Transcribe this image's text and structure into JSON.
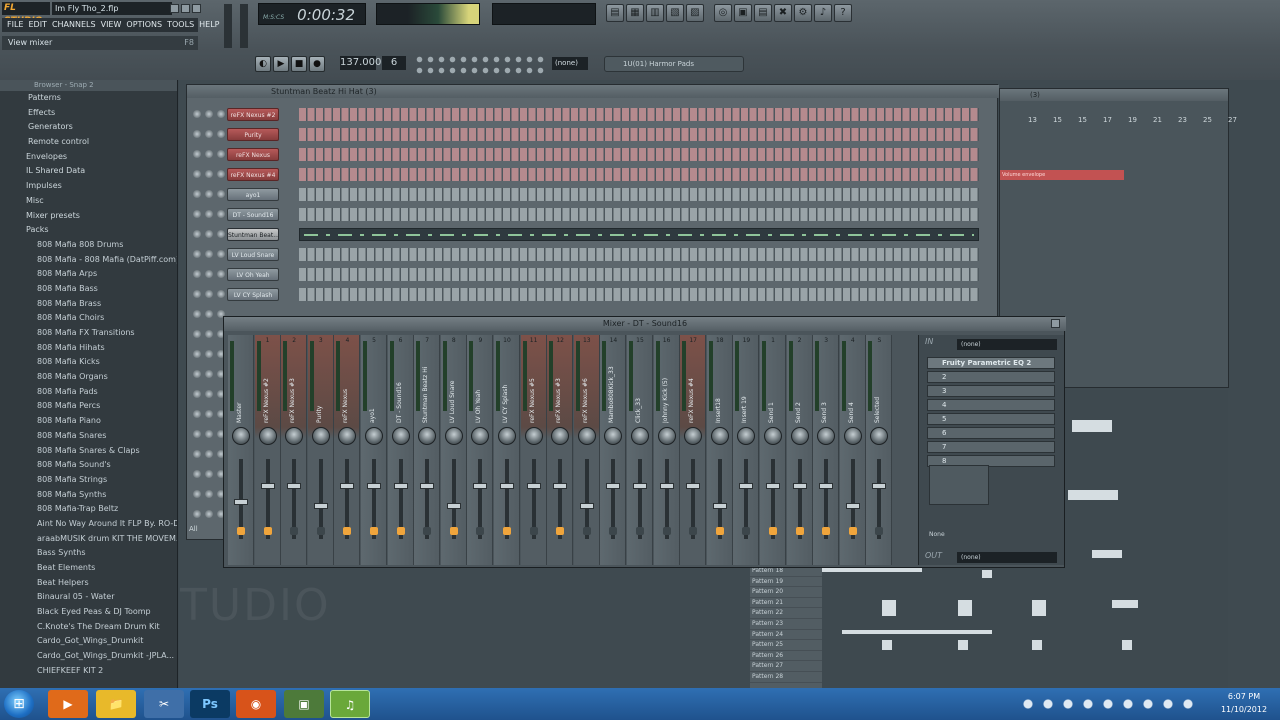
{
  "app": {
    "logo": "FL STUDIO",
    "song_title": "Im Fly Tho_2.flp",
    "hint": "View mixer",
    "hint_key": "F8"
  },
  "menu": [
    "FILE",
    "EDIT",
    "CHANNELS",
    "VIEW",
    "OPTIONS",
    "TOOLS",
    "HELP"
  ],
  "transport": {
    "time": "0:00:32",
    "tempo": "137.000",
    "pattern": "6",
    "snap": "(none)",
    "hint_panel": "1U(01) Harmor Pads"
  },
  "browser": {
    "title": "Browser - Snap 2",
    "folders": [
      "Patterns",
      "Effects",
      "Generators",
      "Remote control"
    ],
    "roots": [
      "Envelopes",
      "IL Shared Data",
      "Impulses",
      "Misc",
      "Mixer presets",
      "Packs"
    ],
    "packs": [
      "808 Mafia 808 Drums",
      "808 Mafia - 808 Mafia (DatPiff.com)",
      "808 Mafia Arps",
      "808 Mafia Bass",
      "808 Mafia Brass",
      "808 Mafia Choirs",
      "808 Mafia FX Transitions",
      "808 Mafia Hihats",
      "808 Mafia Kicks",
      "808 Mafia Organs",
      "808 Mafia Pads",
      "808 Mafia Percs",
      "808 Mafia Piano",
      "808 Mafia Snares",
      "808 Mafia Snares & Claps",
      "808 Mafia Sound's",
      "808 Mafia Strings",
      "808 Mafia Synths",
      "808 Mafia-Trap Beltz",
      "Aint No Way Around It FLP By. RO-D",
      "araabMUSIK drum KIT THE MOVEM...",
      "Bass Synths",
      "Beat Elements",
      "Beat Helpers",
      "Binaural 05 - Water",
      "Black Eyed Peas & DJ Toomp",
      "C.Knote's The Dream Drum Kit",
      "Cardo_Got_Wings_Drumkit",
      "Cardo_Got_Wings_Drumkit -JPLA...",
      "CHIEFKEEF KIT 2"
    ]
  },
  "step_sequencer": {
    "title": "Stuntman Beatz Hi Hat (3)",
    "filter": "All",
    "channels": [
      {
        "label": "reFX Nexus #2",
        "style": "red"
      },
      {
        "label": "Purity",
        "style": "red"
      },
      {
        "label": "reFX Nexus",
        "style": "red"
      },
      {
        "label": "reFX Nexus #4",
        "style": "red"
      },
      {
        "label": "ayo1",
        "style": "grey"
      },
      {
        "label": "DT - Sound16",
        "style": "grey"
      },
      {
        "label": "Stuntman Beat...",
        "style": "sel"
      },
      {
        "label": "LV Loud Snare",
        "style": "grey"
      },
      {
        "label": "LV Oh Yeah",
        "style": "grey"
      },
      {
        "label": "LV CY Splash",
        "style": "grey"
      }
    ]
  },
  "playlist": {
    "title": "(3)",
    "ruler": [
      "13",
      "15",
      "15",
      "17",
      "19",
      "21",
      "23",
      "25",
      "27"
    ],
    "envelope": "Volume envelope",
    "patterns": [
      "Pattern 18",
      "Pattern 19",
      "Pattern 20",
      "Pattern 21",
      "Pattern 22",
      "Pattern 23",
      "Pattern 24",
      "Pattern 25",
      "Pattern 26",
      "Pattern 27",
      "Pattern 28"
    ]
  },
  "mixer": {
    "title": "Mixer - DT - Sound16",
    "tracks": [
      {
        "num": "",
        "name": "Master",
        "led": true
      },
      {
        "num": "1",
        "name": "reFX Nexus #2",
        "led": true,
        "red": true
      },
      {
        "num": "2",
        "name": "reFX Nexus #3",
        "led": false,
        "red": true
      },
      {
        "num": "3",
        "name": "Purity",
        "led": false,
        "red": true
      },
      {
        "num": "4",
        "name": "reFX Nexus",
        "led": true,
        "red": true
      },
      {
        "num": "5",
        "name": "ayo1",
        "led": true
      },
      {
        "num": "6",
        "name": "DT - Sound16",
        "led": true
      },
      {
        "num": "7",
        "name": "Stuntman Beatz Hi Hat",
        "led": false
      },
      {
        "num": "8",
        "name": "LV Loud Snare",
        "led": true
      },
      {
        "num": "9",
        "name": "LV Oh Yeah",
        "led": false
      },
      {
        "num": "10",
        "name": "LV CY Splash",
        "led": true
      },
      {
        "num": "11",
        "name": "reFX Nexus #5",
        "led": false,
        "red": true
      },
      {
        "num": "12",
        "name": "reFX Nexus #3",
        "led": true,
        "red": true
      },
      {
        "num": "13",
        "name": "reFX Nexus #6",
        "led": false,
        "red": true
      },
      {
        "num": "14",
        "name": "Mambo808Kick_33",
        "led": false
      },
      {
        "num": "15",
        "name": "Click_33",
        "led": false
      },
      {
        "num": "16",
        "name": "Johnny Kick (5)",
        "led": false
      },
      {
        "num": "17",
        "name": "reFX Nexus #4",
        "led": false,
        "red": true
      },
      {
        "num": "18",
        "name": "Insert18",
        "led": true
      },
      {
        "num": "19",
        "name": "Insert 19",
        "led": false
      },
      {
        "num": "1",
        "name": "Send 1",
        "led": true
      },
      {
        "num": "2",
        "name": "Send 2",
        "led": true
      },
      {
        "num": "3",
        "name": "Send 3",
        "led": true
      },
      {
        "num": "4",
        "name": "Send 4",
        "led": true
      },
      {
        "num": "S",
        "name": "Selected",
        "led": false
      }
    ],
    "fx": {
      "in": "IN",
      "in_value": "(none)",
      "slots": [
        "Fruity Parametric EQ 2",
        "2",
        "3",
        "4",
        "5",
        "6",
        "7",
        "8"
      ],
      "out": "OUT",
      "out_value": "(none)",
      "none_label": "None"
    }
  },
  "taskbar": {
    "time": "6:07 PM",
    "date": "11/10/2012",
    "apps": [
      "start",
      "media",
      "explorer",
      "cutting",
      "ps",
      "firefox",
      "program1",
      "flstudio"
    ]
  }
}
